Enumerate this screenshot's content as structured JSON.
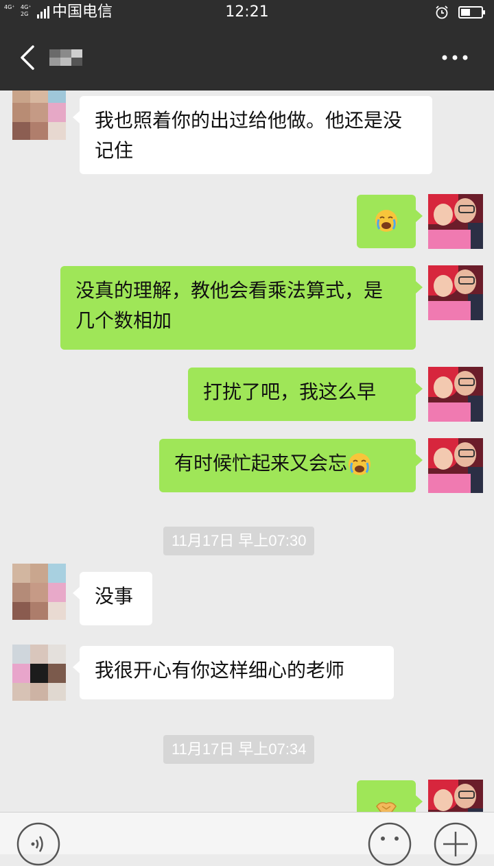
{
  "status_bar": {
    "network_1": "4G⁺",
    "network_2": "4G⁺",
    "network_3": "2G",
    "carrier": "中国电信",
    "time": "12:21",
    "icons": [
      "signal-icon",
      "alarm-icon",
      "battery-icon"
    ]
  },
  "nav": {
    "contact_name": "",
    "icons": [
      "back-icon",
      "more-icon"
    ]
  },
  "messages": [
    {
      "side": "in",
      "text": "我也照着你的出过给他做。他还是没记住"
    },
    {
      "side": "out",
      "text": "",
      "emoji": "crying-face-emoji"
    },
    {
      "side": "out",
      "text": "没真的理解，教他会看乘法算式，是几个数相加"
    },
    {
      "side": "out",
      "text": "打扰了吧，我这么早"
    },
    {
      "side": "out",
      "text": "有时候忙起来又会忘",
      "emoji": "crying-face-emoji"
    },
    {
      "side": "time",
      "text": "11月17日 早上07:30"
    },
    {
      "side": "in",
      "text": "没事"
    },
    {
      "side": "in",
      "text": "我很开心有你这样细心的老师"
    },
    {
      "side": "time",
      "text": "11月17日 早上07:34"
    },
    {
      "side": "out",
      "text": "",
      "emoji": "handshake-emoji"
    }
  ],
  "input_bar": {
    "icons": [
      "voice-icon",
      "emoji-icon",
      "plus-icon"
    ]
  },
  "colors": {
    "bar_bg": "#2e2e2e",
    "chat_bg": "#ebebeb",
    "outgoing_bubble": "#9fe658",
    "incoming_bubble": "#ffffff",
    "timestamp_bg": "#d6d6d6"
  }
}
